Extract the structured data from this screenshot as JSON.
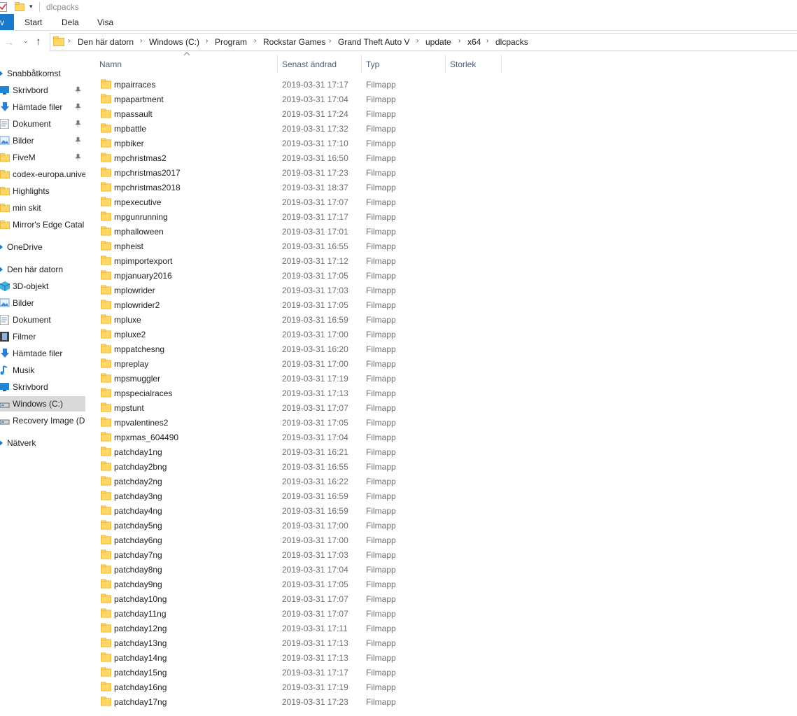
{
  "titlebar": {
    "title": "dlcpacks"
  },
  "ribbon": {
    "file_tab": "v",
    "tabs": [
      "Start",
      "Dela",
      "Visa"
    ]
  },
  "address": {
    "crumbs": [
      "Den här datorn",
      "Windows (C:)",
      "Program",
      "Rockstar Games",
      "Grand Theft Auto V",
      "update",
      "x64",
      "dlcpacks"
    ]
  },
  "columns": {
    "name": "Namn",
    "date": "Senast ändrad",
    "type": "Typ",
    "size": "Storlek"
  },
  "sidebar": {
    "items": [
      {
        "label": "Snabbåtkomst",
        "icon": "star-icon"
      },
      {
        "label": "Skrivbord",
        "icon": "desktop-icon",
        "pinned": true
      },
      {
        "label": "Hämtade filer",
        "icon": "download-icon",
        "pinned": true
      },
      {
        "label": "Dokument",
        "icon": "document-icon",
        "pinned": true
      },
      {
        "label": "Bilder",
        "icon": "pictures-icon",
        "pinned": true
      },
      {
        "label": "FiveM",
        "icon": "folder-icon",
        "pinned": true
      },
      {
        "label": "codex-europa.unive",
        "icon": "folder-icon"
      },
      {
        "label": "Highlights",
        "icon": "folder-icon"
      },
      {
        "label": "min skit",
        "icon": "folder-icon"
      },
      {
        "label": "Mirror's Edge Catal",
        "icon": "folder-icon"
      },
      {
        "label": "OneDrive",
        "icon": "cloud-icon"
      },
      {
        "label": "Den här datorn",
        "icon": "computer-icon"
      },
      {
        "label": "3D-objekt",
        "icon": "cube-icon"
      },
      {
        "label": "Bilder",
        "icon": "pictures-icon"
      },
      {
        "label": "Dokument",
        "icon": "document-icon"
      },
      {
        "label": "Filmer",
        "icon": "film-icon"
      },
      {
        "label": "Hämtade filer",
        "icon": "download-icon"
      },
      {
        "label": "Musik",
        "icon": "music-icon"
      },
      {
        "label": "Skrivbord",
        "icon": "desktop-icon"
      },
      {
        "label": "Windows (C:)",
        "icon": "drive-icon",
        "selected": true
      },
      {
        "label": "Recovery Image (D:",
        "icon": "drive-icon"
      },
      {
        "label": "Nätverk",
        "icon": "network-icon"
      }
    ]
  },
  "files": [
    {
      "name": "mpairraces",
      "date": "2019-03-31 17:17",
      "type": "Filmapp"
    },
    {
      "name": "mpapartment",
      "date": "2019-03-31 17:04",
      "type": "Filmapp"
    },
    {
      "name": "mpassault",
      "date": "2019-03-31 17:24",
      "type": "Filmapp"
    },
    {
      "name": "mpbattle",
      "date": "2019-03-31 17:32",
      "type": "Filmapp"
    },
    {
      "name": "mpbiker",
      "date": "2019-03-31 17:10",
      "type": "Filmapp"
    },
    {
      "name": "mpchristmas2",
      "date": "2019-03-31 16:50",
      "type": "Filmapp"
    },
    {
      "name": "mpchristmas2017",
      "date": "2019-03-31 17:23",
      "type": "Filmapp"
    },
    {
      "name": "mpchristmas2018",
      "date": "2019-03-31 18:37",
      "type": "Filmapp"
    },
    {
      "name": "mpexecutive",
      "date": "2019-03-31 17:07",
      "type": "Filmapp"
    },
    {
      "name": "mpgunrunning",
      "date": "2019-03-31 17:17",
      "type": "Filmapp"
    },
    {
      "name": "mphalloween",
      "date": "2019-03-31 17:01",
      "type": "Filmapp"
    },
    {
      "name": "mpheist",
      "date": "2019-03-31 16:55",
      "type": "Filmapp"
    },
    {
      "name": "mpimportexport",
      "date": "2019-03-31 17:12",
      "type": "Filmapp"
    },
    {
      "name": "mpjanuary2016",
      "date": "2019-03-31 17:05",
      "type": "Filmapp"
    },
    {
      "name": "mplowrider",
      "date": "2019-03-31 17:03",
      "type": "Filmapp"
    },
    {
      "name": "mplowrider2",
      "date": "2019-03-31 17:05",
      "type": "Filmapp"
    },
    {
      "name": "mpluxe",
      "date": "2019-03-31 16:59",
      "type": "Filmapp"
    },
    {
      "name": "mpluxe2",
      "date": "2019-03-31 17:00",
      "type": "Filmapp"
    },
    {
      "name": "mppatchesng",
      "date": "2019-03-31 16:20",
      "type": "Filmapp"
    },
    {
      "name": "mpreplay",
      "date": "2019-03-31 17:00",
      "type": "Filmapp"
    },
    {
      "name": "mpsmuggler",
      "date": "2019-03-31 17:19",
      "type": "Filmapp"
    },
    {
      "name": "mpspecialraces",
      "date": "2019-03-31 17:13",
      "type": "Filmapp"
    },
    {
      "name": "mpstunt",
      "date": "2019-03-31 17:07",
      "type": "Filmapp"
    },
    {
      "name": "mpvalentines2",
      "date": "2019-03-31 17:05",
      "type": "Filmapp"
    },
    {
      "name": "mpxmas_604490",
      "date": "2019-03-31 17:04",
      "type": "Filmapp"
    },
    {
      "name": "patchday1ng",
      "date": "2019-03-31 16:21",
      "type": "Filmapp"
    },
    {
      "name": "patchday2bng",
      "date": "2019-03-31 16:55",
      "type": "Filmapp"
    },
    {
      "name": "patchday2ng",
      "date": "2019-03-31 16:22",
      "type": "Filmapp"
    },
    {
      "name": "patchday3ng",
      "date": "2019-03-31 16:59",
      "type": "Filmapp"
    },
    {
      "name": "patchday4ng",
      "date": "2019-03-31 16:59",
      "type": "Filmapp"
    },
    {
      "name": "patchday5ng",
      "date": "2019-03-31 17:00",
      "type": "Filmapp"
    },
    {
      "name": "patchday6ng",
      "date": "2019-03-31 17:00",
      "type": "Filmapp"
    },
    {
      "name": "patchday7ng",
      "date": "2019-03-31 17:03",
      "type": "Filmapp"
    },
    {
      "name": "patchday8ng",
      "date": "2019-03-31 17:04",
      "type": "Filmapp"
    },
    {
      "name": "patchday9ng",
      "date": "2019-03-31 17:05",
      "type": "Filmapp"
    },
    {
      "name": "patchday10ng",
      "date": "2019-03-31 17:07",
      "type": "Filmapp"
    },
    {
      "name": "patchday11ng",
      "date": "2019-03-31 17:07",
      "type": "Filmapp"
    },
    {
      "name": "patchday12ng",
      "date": "2019-03-31 17:11",
      "type": "Filmapp"
    },
    {
      "name": "patchday13ng",
      "date": "2019-03-31 17:13",
      "type": "Filmapp"
    },
    {
      "name": "patchday14ng",
      "date": "2019-03-31 17:13",
      "type": "Filmapp"
    },
    {
      "name": "patchday15ng",
      "date": "2019-03-31 17:17",
      "type": "Filmapp"
    },
    {
      "name": "patchday16ng",
      "date": "2019-03-31 17:19",
      "type": "Filmapp"
    },
    {
      "name": "patchday17ng",
      "date": "2019-03-31 17:23",
      "type": "Filmapp"
    }
  ],
  "colors": {
    "folder": "#ffd766",
    "folder_dark": "#e8b740",
    "accent": "#1979ca",
    "header_text": "#4c607a",
    "meta_text": "#6d6d6d",
    "selected_bg": "#d9d9d9"
  }
}
